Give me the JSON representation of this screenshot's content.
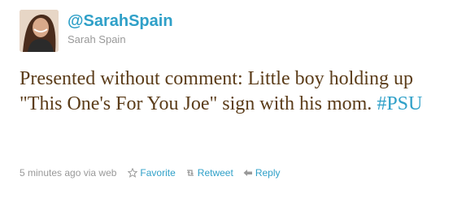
{
  "user": {
    "screen_name": "@SarahSpain",
    "full_name": "Sarah Spain"
  },
  "tweet": {
    "text_before_hashtag": "Presented without comment: Little boy holding up \"This One's For You Joe\" sign with his mom. ",
    "hashtag": "#PSU"
  },
  "meta": {
    "timestamp": "5 minutes ago",
    "via": "via web",
    "actions": {
      "favorite": "Favorite",
      "retweet": "Retweet",
      "reply": "Reply"
    }
  },
  "colors": {
    "link": "#2fa0c8",
    "text": "#5b3c19",
    "muted": "#999999"
  }
}
